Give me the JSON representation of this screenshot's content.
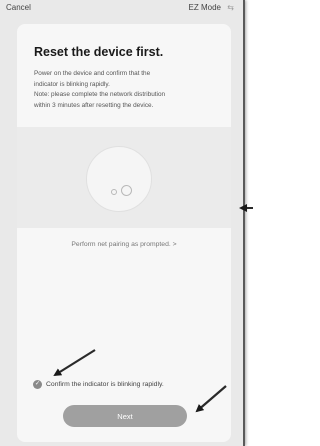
{
  "topbar": {
    "cancel_label": "Cancel",
    "mode_label": "EZ Mode",
    "mode_icon": "⇆"
  },
  "content": {
    "title": "Reset the device first.",
    "description_lines": [
      "Power on the device and confirm that the",
      "indicator is blinking rapidly.",
      "Note: please complete the network distribution",
      "within 3 minutes after resetting the device."
    ],
    "pairing_link": "Perform net pairing as prompted. >",
    "confirm_label": "Confirm the indicator is blinking rapidly.",
    "confirm_checked": true,
    "next_label": "Next"
  },
  "colors": {
    "screen_bg": "#e9e9e9",
    "card_bg": "#f7f7f7",
    "button_bg": "#a0a0a0",
    "annotation_arrow": "#1a1a1a"
  }
}
